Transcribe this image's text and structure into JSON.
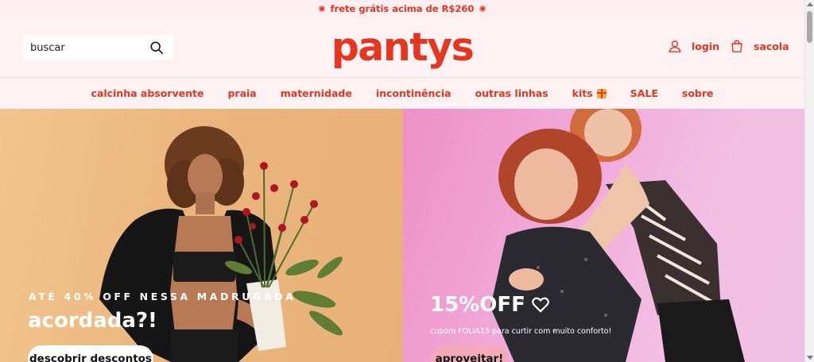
{
  "announcement": {
    "text": "frete grátis acima de R$260",
    "icon": "sparkle-icon"
  },
  "header": {
    "search_placeholder": "buscar",
    "logo": "pantys",
    "login_label": "login",
    "bag_label": "sacola"
  },
  "nav": {
    "items": [
      {
        "label": "calcinha absorvente"
      },
      {
        "label": "praia"
      },
      {
        "label": "maternidade"
      },
      {
        "label": "incontinência"
      },
      {
        "label": "outras linhas"
      },
      {
        "label": "kits",
        "icon": "gift-icon"
      },
      {
        "label": "SALE"
      },
      {
        "label": "sobre"
      }
    ]
  },
  "banners": [
    {
      "eyebrow": "ATÉ 40% OFF NESSA MADRUGADA",
      "headline": "acordada?!",
      "cta": "descobrir descontos",
      "image": "woman in black blazer holding red roses on peach background"
    },
    {
      "headline": "15%OFF",
      "headline_icon": "heart-outline-icon",
      "subtext": "cupom FOLIA15 para curtir com muito conforto!",
      "cta": "aproveitar!",
      "image": "two women hugging, pink background"
    }
  ],
  "colors": {
    "brand": "#e5361f",
    "header_bg": "#fff2f4",
    "announce_bg": "#fdeef1",
    "cta_left": "#ffffff",
    "cta_right": "#f4a9b9"
  }
}
